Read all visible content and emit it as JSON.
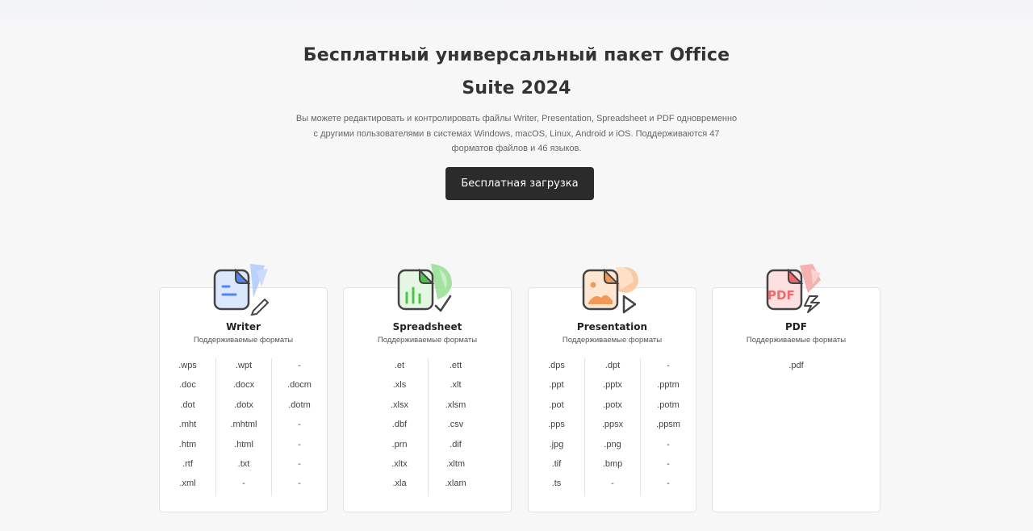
{
  "hero": {
    "title_line1": "Бесплатный универсальный пакет Office",
    "title_line2": "Suite 2024",
    "description_line1": "Вы можете редактировать и контролировать файлы Writer, Presentation, Spreadsheet и PDF одновременно",
    "description_line2": "с другими пользователями в системах Windows, macOS, Linux, Android и iOS. Поддерживаются 47",
    "description_line3": "форматов файлов и 46 языков.",
    "cta_label": "Бесплатная загрузка"
  },
  "cards": [
    {
      "title": "Writer",
      "subtitle": "Поддерживаемые форматы",
      "icon": "writer-document-icon",
      "accent": "#4f86f7",
      "columns": [
        [
          ".wps",
          ".doc",
          ".dot",
          ".mht",
          ".htm",
          ".rtf",
          ".xml"
        ],
        [
          ".wpt",
          ".docx",
          ".dotx",
          ".mhtml",
          ".html",
          ".txt",
          "-"
        ],
        [
          "-",
          ".docm",
          ".dotm",
          "-",
          "-",
          "-",
          "-"
        ]
      ]
    },
    {
      "title": "Spreadsheet",
      "subtitle": "Поддерживаемые форматы",
      "icon": "spreadsheet-chart-icon",
      "accent": "#4cc44a",
      "columns": [
        [
          ".et",
          ".xls",
          ".xlsx",
          ".dbf",
          ".prn",
          ".xltx",
          ".xla"
        ],
        [
          ".ett",
          ".xlt",
          ".xlsm",
          ".csv",
          ".dif",
          ".xltm",
          ".xlam"
        ]
      ]
    },
    {
      "title": "Presentation",
      "subtitle": "Поддерживаемые форматы",
      "icon": "presentation-slide-icon",
      "accent": "#f29a55",
      "columns": [
        [
          ".dps",
          ".ppt",
          ".pot",
          ".pps",
          ".jpg",
          ".tif",
          ".ts"
        ],
        [
          ".dpt",
          ".pptx",
          ".potx",
          ".ppsx",
          ".png",
          ".bmp",
          "-"
        ],
        [
          "-",
          ".pptm",
          ".potm",
          ".ppsm",
          "-",
          "-",
          "-"
        ]
      ]
    },
    {
      "title": "PDF",
      "subtitle": "Поддерживаемые форматы",
      "icon": "pdf-document-icon",
      "accent": "#ef6b6b",
      "columns": [
        [
          ".pdf"
        ]
      ]
    }
  ]
}
